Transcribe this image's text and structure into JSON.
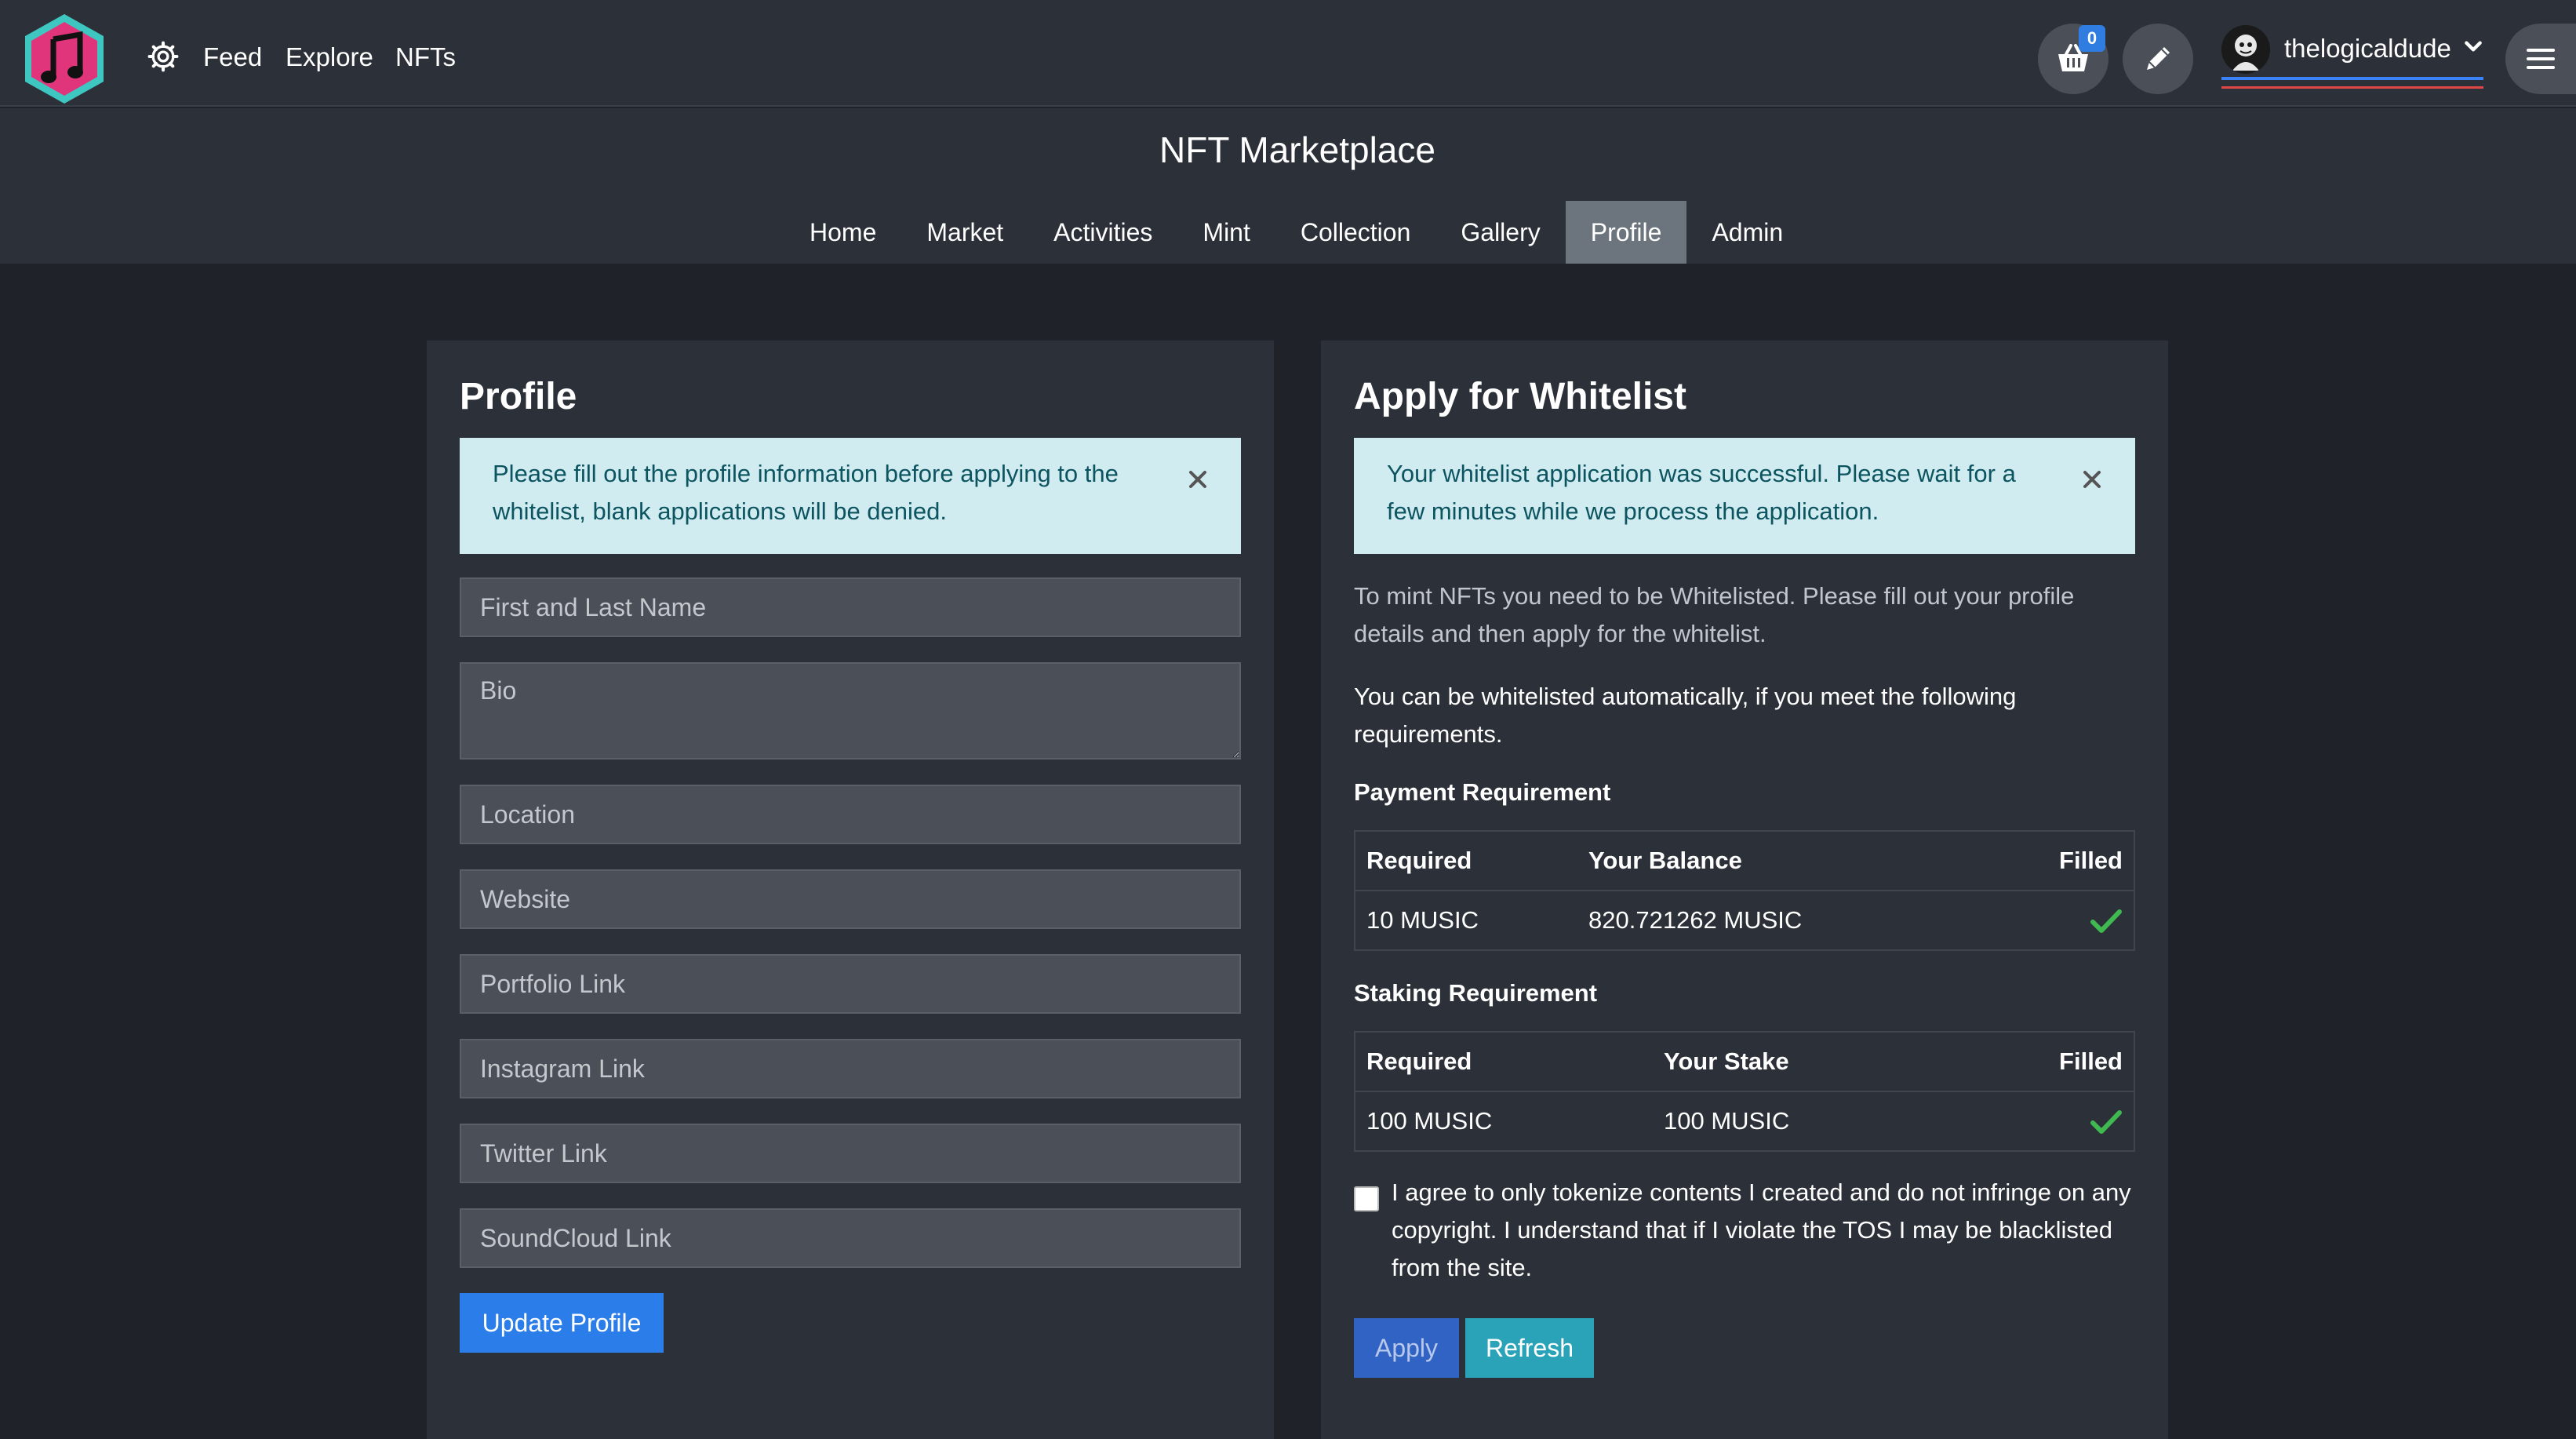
{
  "navbar": {
    "links": [
      "Feed",
      "Explore",
      "NFTs"
    ],
    "cart_count": "0",
    "username": "thelogicaldude"
  },
  "header": {
    "title": "NFT Marketplace",
    "tabs": [
      "Home",
      "Market",
      "Activities",
      "Mint",
      "Collection",
      "Gallery",
      "Profile",
      "Admin"
    ],
    "active_tab": "Profile"
  },
  "profile": {
    "title": "Profile",
    "alert": "Please fill out the profile information before applying to the whitelist, blank applications will be denied.",
    "fields": {
      "name": "First and Last Name",
      "bio": "Bio",
      "location": "Location",
      "website": "Website",
      "portfolio": "Portfolio Link",
      "instagram": "Instagram Link",
      "twitter": "Twitter Link",
      "soundcloud": "SoundCloud Link"
    },
    "update_label": "Update Profile"
  },
  "whitelist": {
    "title": "Apply for Whitelist",
    "alert": "Your whitelist application was successful. Please wait for a few minutes while we process the application.",
    "intro": "To mint NFTs you need to be Whitelisted. Please fill out your profile details and then apply for the whitelist.",
    "auto": "You can be whitelisted automatically, if you meet the following requirements.",
    "payment": {
      "heading": "Payment Requirement",
      "headers": [
        "Required",
        "Your Balance",
        "Filled"
      ],
      "required": "10 MUSIC",
      "balance": "820.721262 MUSIC"
    },
    "staking": {
      "heading": "Staking Requirement",
      "headers": [
        "Required",
        "Your Stake",
        "Filled"
      ],
      "required": "100 MUSIC",
      "stake": "100 MUSIC"
    },
    "agree_text": "I agree to only tokenize contents I created and do not infringe on any copyright. I understand that if I violate the TOS I may be blacklisted from the site.",
    "apply_label": "Apply",
    "refresh_label": "Refresh"
  },
  "colors": {
    "background": "#1f2329",
    "panel": "#2c3038",
    "alert_bg": "#d1ecf1",
    "primary": "#2b7de9",
    "info": "#2aa3b8",
    "success": "#3fb950",
    "logo_pink": "#e0357a",
    "logo_teal": "#3ec6c0"
  },
  "icons": {
    "logo": "music-note-hexagon-logo",
    "settings": "gear-icon",
    "cart": "basket-icon",
    "edit": "pencil-icon",
    "user_menu": "chevron-down-icon",
    "menu": "hamburger-icon",
    "close": "close-icon",
    "filled": "check-icon"
  }
}
